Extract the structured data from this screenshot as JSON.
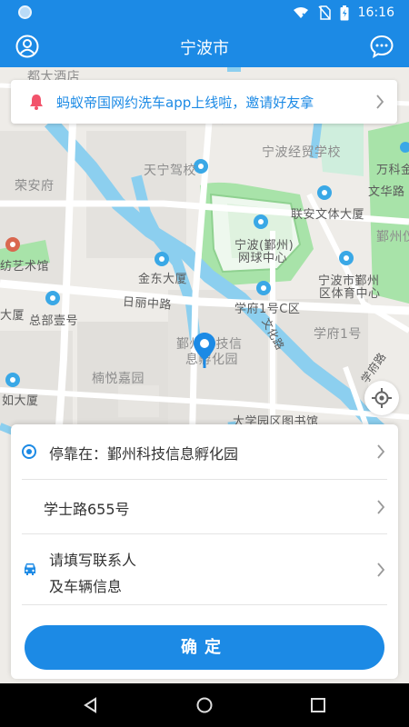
{
  "status_bar": {
    "time": "16:16"
  },
  "header": {
    "title": "宁波市",
    "left_icon": "user-icon",
    "right_icon": "chat-icon"
  },
  "banner": {
    "text": "蚂蚁帝国网约洗车app上线啦，邀请好友拿",
    "icon": "bell-icon"
  },
  "map": {
    "labels": [
      "都大酒店",
      "天宁驾校",
      "宁波经贸学校",
      "万科金",
      "荣安府",
      "文华路",
      "联安文体大厦",
      "鄞州仪",
      "宁波(鄞州)",
      "网球中心",
      "纺艺术馆",
      "金东大厦",
      "宁波市鄞州",
      "区体育中心",
      "日丽中路",
      "学府1号C区",
      "总部壹号",
      "大厦",
      "文化路",
      "学府1号",
      "鄞州科技信",
      "息孵化园",
      "楠悦嘉园",
      "如大厦",
      "大学园区图书馆",
      "学府路"
    ]
  },
  "panel": {
    "stop_label": "停靠在：鄞州科技信息孵化园",
    "address": "学士路655号",
    "contact_line1": "请填写联系人",
    "contact_line2": "及车辆信息",
    "confirm_label": "确定"
  },
  "colors": {
    "accent": "#1c8ae5",
    "water": "#8ccfef",
    "green": "#a7e2a8"
  }
}
